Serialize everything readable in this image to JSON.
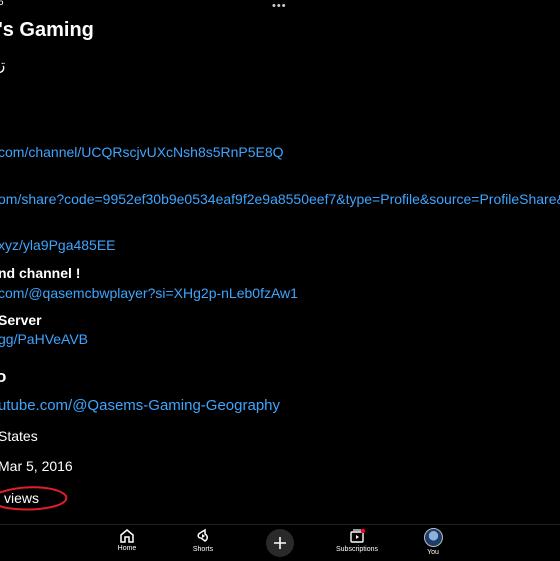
{
  "status_bar": {
    "time_fragment": "6",
    "more_dots": "•••"
  },
  "channel": {
    "title_fragment": "'s Gaming",
    "glyph": "ڗ"
  },
  "links": [
    {
      "url": "com/channel/UCQRscjvUXcNsh8s5RnP5E8Q"
    },
    {
      "url": "om/share?code=9952ef30b9e0534eaf9f2e9a8550eef7&type=Profile&source=ProfileShare&"
    },
    {
      "url": "xyz/yla9Pga485EE"
    },
    {
      "label": "nd channel !",
      "url": "com/@qasemcbwplayer?si=XHg2p-nLeb0fzAw1"
    },
    {
      "label": "Server",
      "url": "gg/PaHVeAVB"
    }
  ],
  "more_info": {
    "heading_fragment": "o",
    "channel_url": "utube.com/@Qasems-Gaming-Geography",
    "country": "States",
    "joined": "Mar 5, 2016",
    "views": "views"
  },
  "bottom_nav": {
    "items": [
      {
        "label": "Home",
        "icon": "home-icon"
      },
      {
        "label": "Shorts",
        "icon": "shorts-icon"
      },
      {
        "label": "",
        "icon": "plus-icon"
      },
      {
        "label": "Subscriptions",
        "icon": "subscriptions-icon"
      },
      {
        "label": "You",
        "icon": "avatar"
      }
    ]
  },
  "colors": {
    "background": "#000000",
    "link": "#3ea6ff",
    "annotation": "#e01f2a",
    "notification_dot": "#ff0033"
  }
}
